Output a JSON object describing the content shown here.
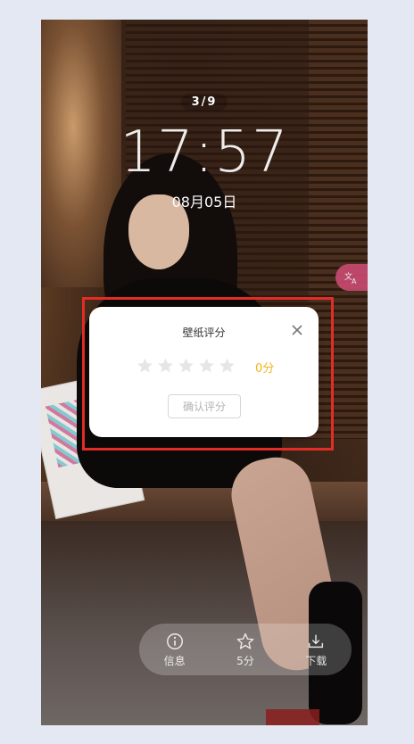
{
  "lockscreen": {
    "counter": "3/9",
    "time": "17:57",
    "date": "08月05日",
    "translate_icon": "translate-icon"
  },
  "dialog": {
    "title": "壁纸评分",
    "stars_total": 5,
    "rating_filled": 0,
    "score_text": "0分",
    "confirm_label": "确认评分",
    "close_icon": "close-icon"
  },
  "action_bar": {
    "items": [
      {
        "label": "信息",
        "icon": "info-icon"
      },
      {
        "label": "5分",
        "icon": "star-icon"
      },
      {
        "label": "下载",
        "icon": "download-icon"
      }
    ]
  },
  "colors": {
    "score": "#f2b41a",
    "highlight": "#e22c26",
    "star_empty": "#e6e6e6"
  }
}
